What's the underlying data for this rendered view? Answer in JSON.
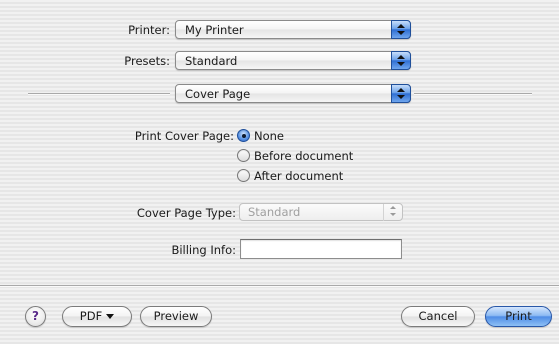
{
  "printer": {
    "label": "Printer:",
    "value": "My Printer"
  },
  "presets": {
    "label": "Presets:",
    "value": "Standard"
  },
  "pane_selector": {
    "value": "Cover Page"
  },
  "cover_page": {
    "label": "Print Cover Page:",
    "options": [
      {
        "label": "None",
        "selected": true
      },
      {
        "label": "Before document",
        "selected": false
      },
      {
        "label": "After document",
        "selected": false
      }
    ]
  },
  "cover_page_type": {
    "label": "Cover Page Type:",
    "value": "Standard",
    "enabled": false
  },
  "billing_info": {
    "label": "Billing Info:",
    "value": ""
  },
  "footer": {
    "help_label": "?",
    "pdf_label": "PDF",
    "preview_label": "Preview",
    "cancel_label": "Cancel",
    "print_label": "Print"
  }
}
